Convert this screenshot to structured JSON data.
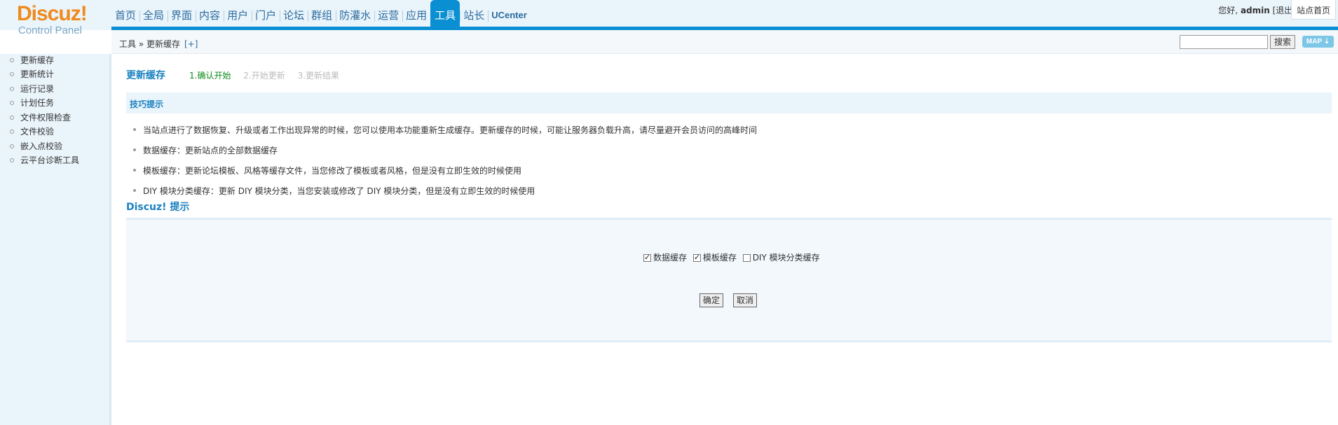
{
  "header": {
    "logo_main": "Discuz!",
    "logo_sub": "Control Panel",
    "nav": [
      {
        "label": "首页"
      },
      {
        "label": "全局"
      },
      {
        "label": "界面"
      },
      {
        "label": "内容"
      },
      {
        "label": "用户"
      },
      {
        "label": "门户"
      },
      {
        "label": "论坛"
      },
      {
        "label": "群组"
      },
      {
        "label": "防灌水"
      },
      {
        "label": "运营"
      },
      {
        "label": "应用"
      },
      {
        "label": "工具",
        "active": true
      },
      {
        "label": "站长"
      },
      {
        "label": "UCenter"
      }
    ],
    "greeting": "您好,",
    "username": "admin",
    "logout": "[退出]",
    "home_link": "站点首页"
  },
  "subbar": {
    "breadcrumb": "工具 » 更新缓存",
    "add": "[+]",
    "search_button": "搜索",
    "map_button": "MAP ⇣"
  },
  "sidebar": {
    "items": [
      {
        "label": "更新缓存"
      },
      {
        "label": "更新统计"
      },
      {
        "label": "运行记录"
      },
      {
        "label": "计划任务"
      },
      {
        "label": "文件权限检查"
      },
      {
        "label": "文件校验"
      },
      {
        "label": "嵌入点校验"
      },
      {
        "label": "云平台诊断工具"
      }
    ]
  },
  "main": {
    "title": "更新缓存",
    "steps": [
      "1.确认开始",
      "2.开始更新",
      "3.更新结果"
    ],
    "tips_title": "技巧提示",
    "tips": [
      "当站点进行了数据恢复、升级或者工作出现异常的时候，您可以使用本功能重新生成缓存。更新缓存的时候，可能让服务器负载升高，请尽量避开会员访问的高峰时间",
      "数据缓存：更新站点的全部数据缓存",
      "模板缓存：更新论坛模板、风格等缓存文件，当您修改了模板或者风格，但是没有立即生效的时候使用",
      "DIY 模块分类缓存：更新 DIY 模块分类，当您安装或修改了 DIY 模块分类，但是没有立即生效的时候使用"
    ],
    "box_title": "Discuz! 提示",
    "checks": [
      {
        "label": "数据缓存",
        "checked": true
      },
      {
        "label": "模板缓存",
        "checked": true
      },
      {
        "label": "DIY 模块分类缓存",
        "checked": false
      }
    ],
    "confirm_button": "确定",
    "cancel_button": "取消"
  },
  "colors": {
    "accent": "#0a8fd2",
    "logo": "#f08a1c",
    "title": "#1a80c0",
    "current_step": "#0f8a1a"
  }
}
